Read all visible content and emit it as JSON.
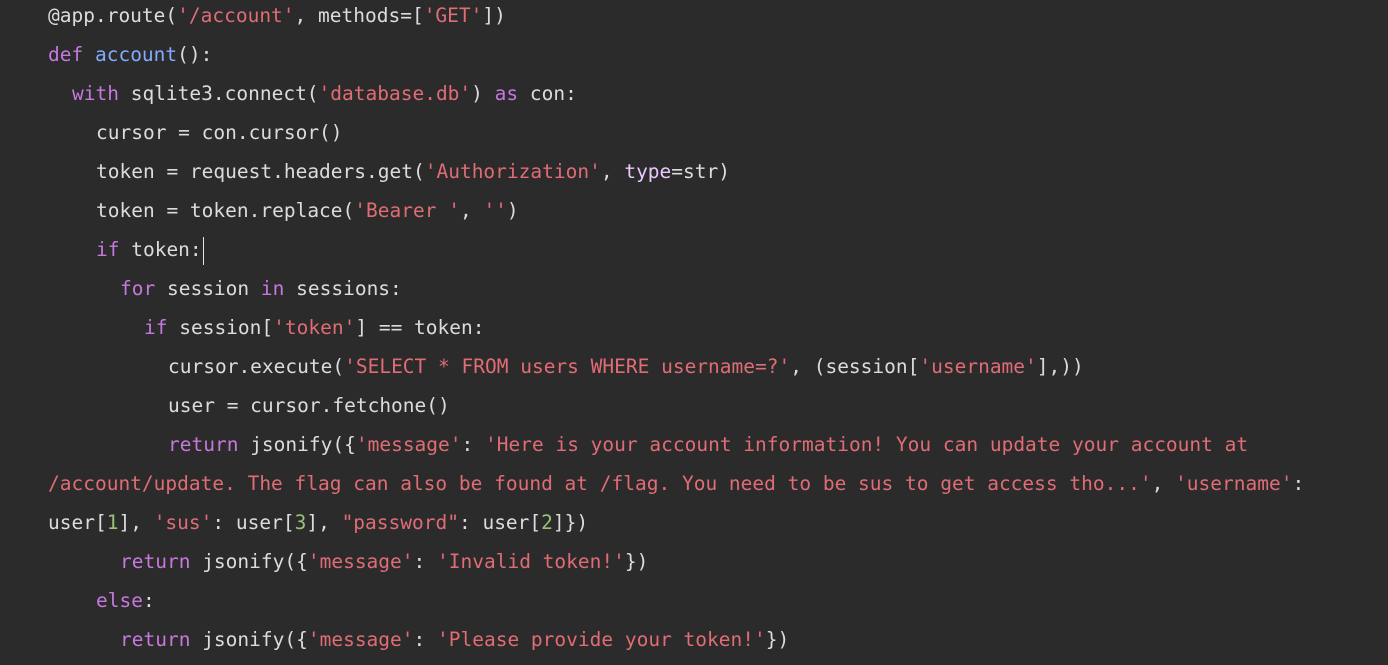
{
  "editor": {
    "background": "#2b2b2b",
    "colors": {
      "plain": "#dcdcdc",
      "keyword": "#c678dd",
      "string": "#e06c75",
      "function": "#82aaff",
      "number": "#98c379",
      "parameter": "#e8c8ff"
    },
    "lines": [
      {
        "indent": 0,
        "tokens": [
          [
            "plain",
            "@app.route("
          ],
          [
            "string",
            "'/account'"
          ],
          [
            "plain",
            ", methods=["
          ],
          [
            "string",
            "'GET'"
          ],
          [
            "plain",
            "])"
          ]
        ]
      },
      {
        "indent": 0,
        "tokens": [
          [
            "keyword",
            "def "
          ],
          [
            "func",
            "account"
          ],
          [
            "plain",
            "():"
          ]
        ]
      },
      {
        "indent": 1,
        "tokens": [
          [
            "keyword",
            "with "
          ],
          [
            "plain",
            "sqlite3.connect("
          ],
          [
            "string",
            "'database.db'"
          ],
          [
            "plain",
            ") "
          ],
          [
            "keyword",
            "as"
          ],
          [
            "plain",
            " con:"
          ]
        ]
      },
      {
        "indent": 2,
        "tokens": [
          [
            "plain",
            "cursor = con.cursor()"
          ]
        ]
      },
      {
        "indent": 2,
        "tokens": [
          [
            "plain",
            "token = request.headers.get("
          ],
          [
            "string",
            "'Authorization'"
          ],
          [
            "plain",
            ", "
          ],
          [
            "param",
            "type"
          ],
          [
            "plain",
            "=str)"
          ]
        ]
      },
      {
        "indent": 2,
        "tokens": [
          [
            "plain",
            "token = token.replace("
          ],
          [
            "string",
            "'Bearer '"
          ],
          [
            "plain",
            ", "
          ],
          [
            "string",
            "''"
          ],
          [
            "plain",
            ")"
          ]
        ]
      },
      {
        "indent": 2,
        "caret": true,
        "tokens": [
          [
            "keyword",
            "if"
          ],
          [
            "plain",
            " token:"
          ]
        ]
      },
      {
        "indent": 3,
        "tokens": [
          [
            "keyword",
            "for"
          ],
          [
            "plain",
            " session "
          ],
          [
            "keyword",
            "in"
          ],
          [
            "plain",
            " sessions:"
          ]
        ]
      },
      {
        "indent": 4,
        "tokens": [
          [
            "keyword",
            "if"
          ],
          [
            "plain",
            " session["
          ],
          [
            "string",
            "'token'"
          ],
          [
            "plain",
            "] == token:"
          ]
        ]
      },
      {
        "indent": 5,
        "tokens": [
          [
            "plain",
            "cursor.execute("
          ],
          [
            "string",
            "'SELECT * FROM users WHERE username=?'"
          ],
          [
            "plain",
            ", (session["
          ],
          [
            "string",
            "'username'"
          ],
          [
            "plain",
            "],))"
          ]
        ]
      },
      {
        "indent": 5,
        "tokens": [
          [
            "plain",
            "user = cursor.fetchone()"
          ]
        ]
      },
      {
        "indent": 5,
        "tokens": [
          [
            "keyword",
            "return "
          ],
          [
            "plain",
            "jsonify({"
          ],
          [
            "string",
            "'message'"
          ],
          [
            "plain",
            ": "
          ],
          [
            "string",
            "'Here is your account information! You can update your account at"
          ]
        ]
      },
      {
        "indent": 0,
        "tokens": [
          [
            "string",
            "/account/update. The flag can also be found at /flag. You need to be sus to get access tho...'"
          ],
          [
            "plain",
            ", "
          ],
          [
            "string",
            "'username'"
          ],
          [
            "plain",
            ":"
          ]
        ]
      },
      {
        "indent": 0,
        "tokens": [
          [
            "plain",
            "user["
          ],
          [
            "number",
            "1"
          ],
          [
            "plain",
            "], "
          ],
          [
            "string",
            "'sus'"
          ],
          [
            "plain",
            ": user["
          ],
          [
            "number",
            "3"
          ],
          [
            "plain",
            "], "
          ],
          [
            "string",
            "\"password\""
          ],
          [
            "plain",
            ": user["
          ],
          [
            "number",
            "2"
          ],
          [
            "plain",
            "]})"
          ]
        ]
      },
      {
        "indent": 3,
        "tokens": [
          [
            "keyword",
            "return "
          ],
          [
            "plain",
            "jsonify({"
          ],
          [
            "string",
            "'message'"
          ],
          [
            "plain",
            ": "
          ],
          [
            "string",
            "'Invalid token!'"
          ],
          [
            "plain",
            "})"
          ]
        ]
      },
      {
        "indent": 2,
        "tokens": [
          [
            "keyword",
            "else"
          ],
          [
            "plain",
            ":"
          ]
        ]
      },
      {
        "indent": 3,
        "tokens": [
          [
            "keyword",
            "return "
          ],
          [
            "plain",
            "jsonify({"
          ],
          [
            "string",
            "'message'"
          ],
          [
            "plain",
            ": "
          ],
          [
            "string",
            "'Please provide your token!'"
          ],
          [
            "plain",
            "})"
          ]
        ]
      }
    ]
  }
}
